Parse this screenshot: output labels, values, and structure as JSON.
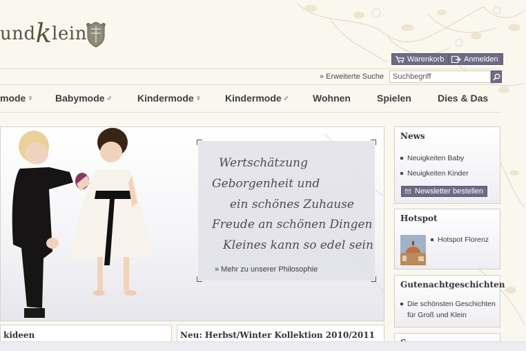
{
  "brand": {
    "logo_text_part1": "und",
    "logo_text_k": "k",
    "logo_text_part2": "lein"
  },
  "header": {
    "cart_label": "Warenkorb",
    "login_label": "Anmelden",
    "extended_search_label": "» Erweiterte Suche",
    "search_value": "Suchbegriff"
  },
  "nav": {
    "items": [
      {
        "label": "mode",
        "symbol": "♀"
      },
      {
        "label": "Babymode",
        "symbol": "♂"
      },
      {
        "label": "Kindermode",
        "symbol": "♀"
      },
      {
        "label": "Kindermode",
        "symbol": "♂"
      },
      {
        "label": "Wohnen",
        "symbol": ""
      },
      {
        "label": "Spielen",
        "symbol": ""
      },
      {
        "label": "Dies & Das",
        "symbol": ""
      }
    ]
  },
  "hero": {
    "quote_lines": [
      "Wertschätzung",
      "Geborgenheit und",
      "ein schönes Zuhause",
      "Freude an schönen Dingen",
      "Kleines kann so edel sein"
    ],
    "philosophy_link": "» Mehr zu unserer Philosophie"
  },
  "bottom": {
    "left_title": "kideen",
    "right_title": "Neu: Herbst/Winter Kollektion 2010/2011"
  },
  "sidebar": {
    "news": {
      "title": "News",
      "items": [
        "Neuigkeiten Baby",
        "Neuigkeiten Kinder"
      ],
      "newsletter_label": "Newsletter bestellen"
    },
    "hotspot": {
      "title": "Hotspot",
      "item": "Hotspot Florenz"
    },
    "stories": {
      "title": "Gutenachtgeschichten",
      "item_line1": "Die schönsten Geschichten",
      "item_line2": "für Groß und Klein"
    },
    "partial_title": "S"
  },
  "colors": {
    "accent": "#6d6b86",
    "background": "#faf7ef",
    "text": "#3a3a3a"
  }
}
